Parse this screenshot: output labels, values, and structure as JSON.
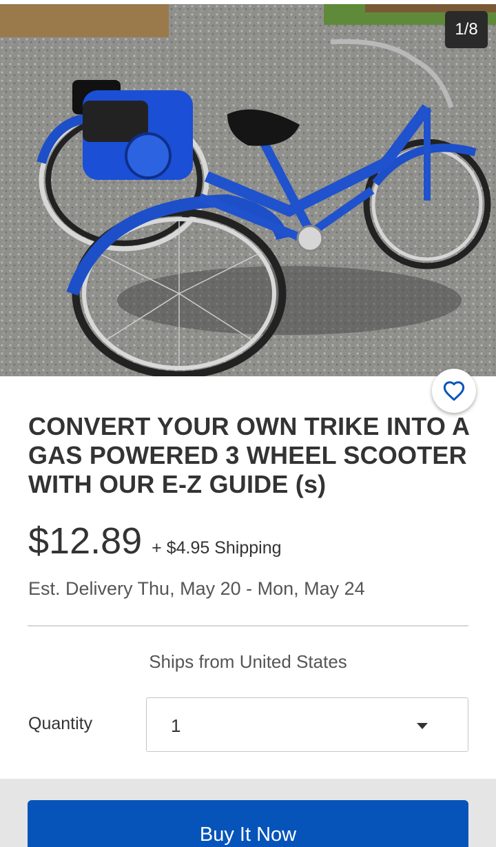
{
  "gallery": {
    "counter": "1/8",
    "image_alt": "Blue tricycle with gas engine mounted on the rear"
  },
  "favorite": {
    "icon": "heart-outline-icon",
    "color": "#0654ba"
  },
  "listing": {
    "title": "CONVERT YOUR OWN TRIKE INTO A GAS POWERED 3 WHEEL SCOOTER WITH OUR E-Z GUIDE (s)",
    "price": "$12.89",
    "shipping": "+ $4.95 Shipping",
    "delivery": "Est. Delivery Thu, May 20 - Mon, May 24",
    "ships_from": "Ships from United States"
  },
  "quantity": {
    "label": "Quantity",
    "value": "1",
    "caret_icon": "caret-down-icon"
  },
  "actions": {
    "buy_now_label": "Buy It Now",
    "accent": "#0654ba"
  }
}
